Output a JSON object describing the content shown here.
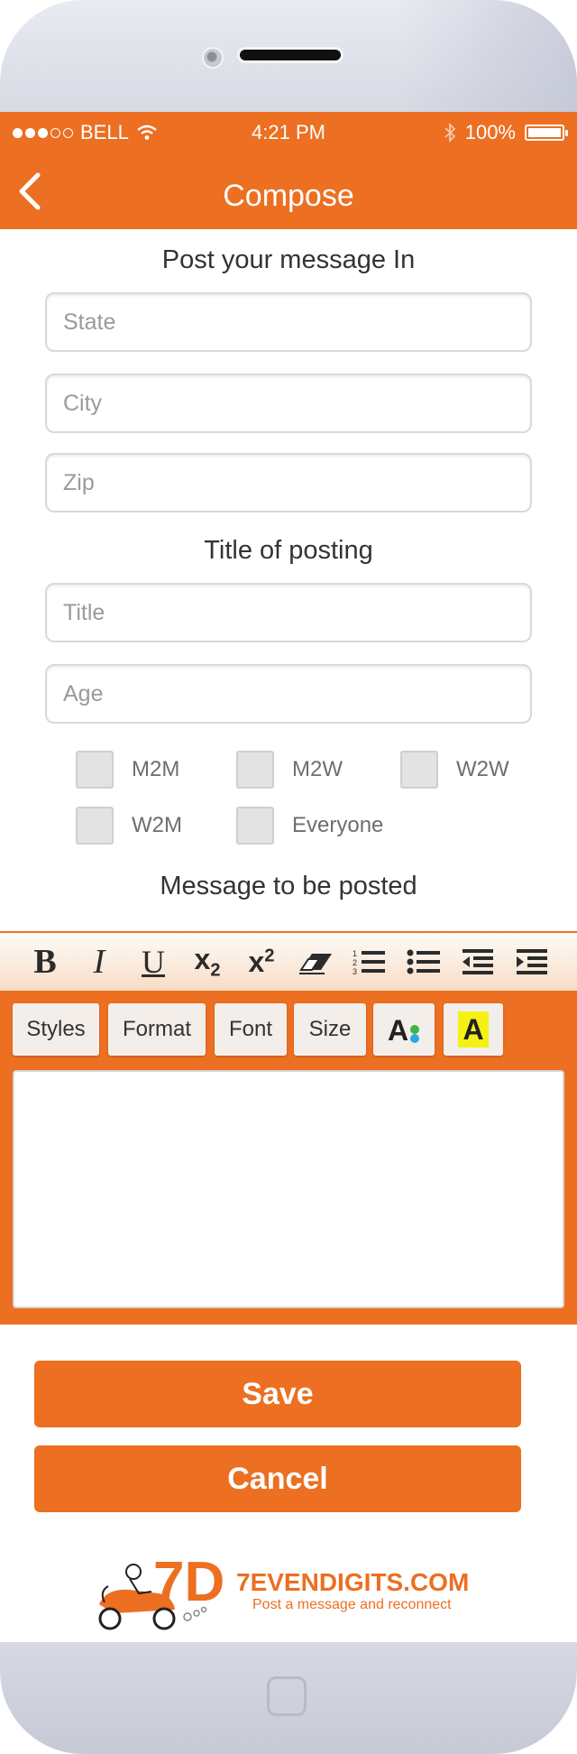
{
  "status_bar": {
    "carrier": "BELL",
    "time": "4:21 PM",
    "battery": "100%",
    "signal_bars_filled": 3,
    "icons": [
      "signal-dots-icon",
      "wifi-icon",
      "bluetooth-icon",
      "battery-icon"
    ]
  },
  "nav": {
    "title": "Compose",
    "back_icon": "chevron-left-icon"
  },
  "location_section": {
    "heading": "Post your message In",
    "state_placeholder": "State",
    "city_placeholder": "City",
    "zip_placeholder": "Zip"
  },
  "posting_section": {
    "heading": "Title of posting",
    "title_placeholder": "Title",
    "age_placeholder": "Age"
  },
  "audience_options": [
    {
      "label": "M2M",
      "checked": false
    },
    {
      "label": "M2W",
      "checked": false
    },
    {
      "label": "W2W",
      "checked": false
    },
    {
      "label": "W2M",
      "checked": false
    },
    {
      "label": "Everyone",
      "checked": false
    }
  ],
  "message_section": {
    "heading": "Message to be posted"
  },
  "editor": {
    "toolbar_icons": [
      "bold-icon",
      "italic-icon",
      "underline-icon",
      "subscript-icon",
      "superscript-icon",
      "eraser-icon",
      "numbered-list-icon",
      "bulleted-list-icon",
      "outdent-icon",
      "indent-icon"
    ],
    "buttons": {
      "styles": "Styles",
      "format": "Format",
      "font": "Font",
      "size": "Size"
    },
    "text_color_icon": "text-color-icon",
    "highlight_icon": "highlight-color-icon",
    "content": ""
  },
  "actions": {
    "save": "Save",
    "cancel": "Cancel"
  },
  "brand": {
    "name": "7EVENDIGITS.COM",
    "tagline": "Post a message and reconnect",
    "accent_color": "#ec6f22"
  }
}
